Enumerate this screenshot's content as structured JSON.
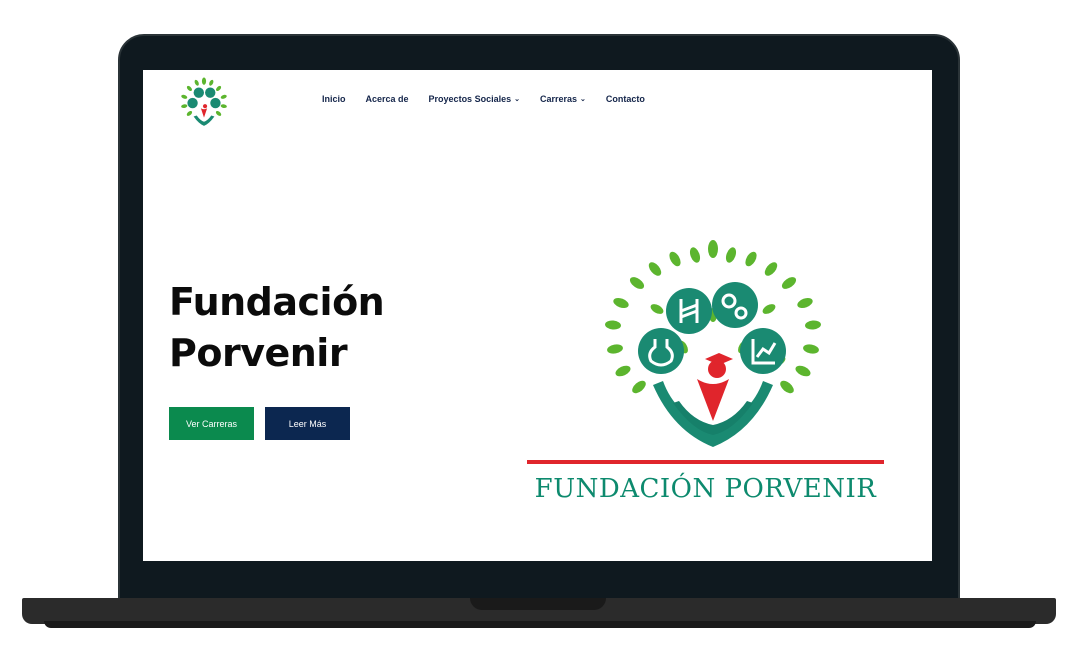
{
  "nav": {
    "items": [
      {
        "label": "Inicio",
        "dropdown": false
      },
      {
        "label": "Acerca de",
        "dropdown": false
      },
      {
        "label": "Proyectos Sociales",
        "dropdown": true
      },
      {
        "label": "Carreras",
        "dropdown": true
      },
      {
        "label": "Contacto",
        "dropdown": false
      }
    ],
    "chevron": "⌄"
  },
  "hero": {
    "title_line1": "Fundación",
    "title_line2": "Porvenir",
    "primary_button": "Ver Carreras",
    "secondary_button": "Leer Más"
  },
  "brand": {
    "name": "FUNDACIÓN PORVENIR"
  },
  "colors": {
    "leaf_green": "#5cb52e",
    "teal": "#1a8a72",
    "red": "#e0252c",
    "navy": "#0c2750",
    "button_green": "#0b8a4e"
  }
}
